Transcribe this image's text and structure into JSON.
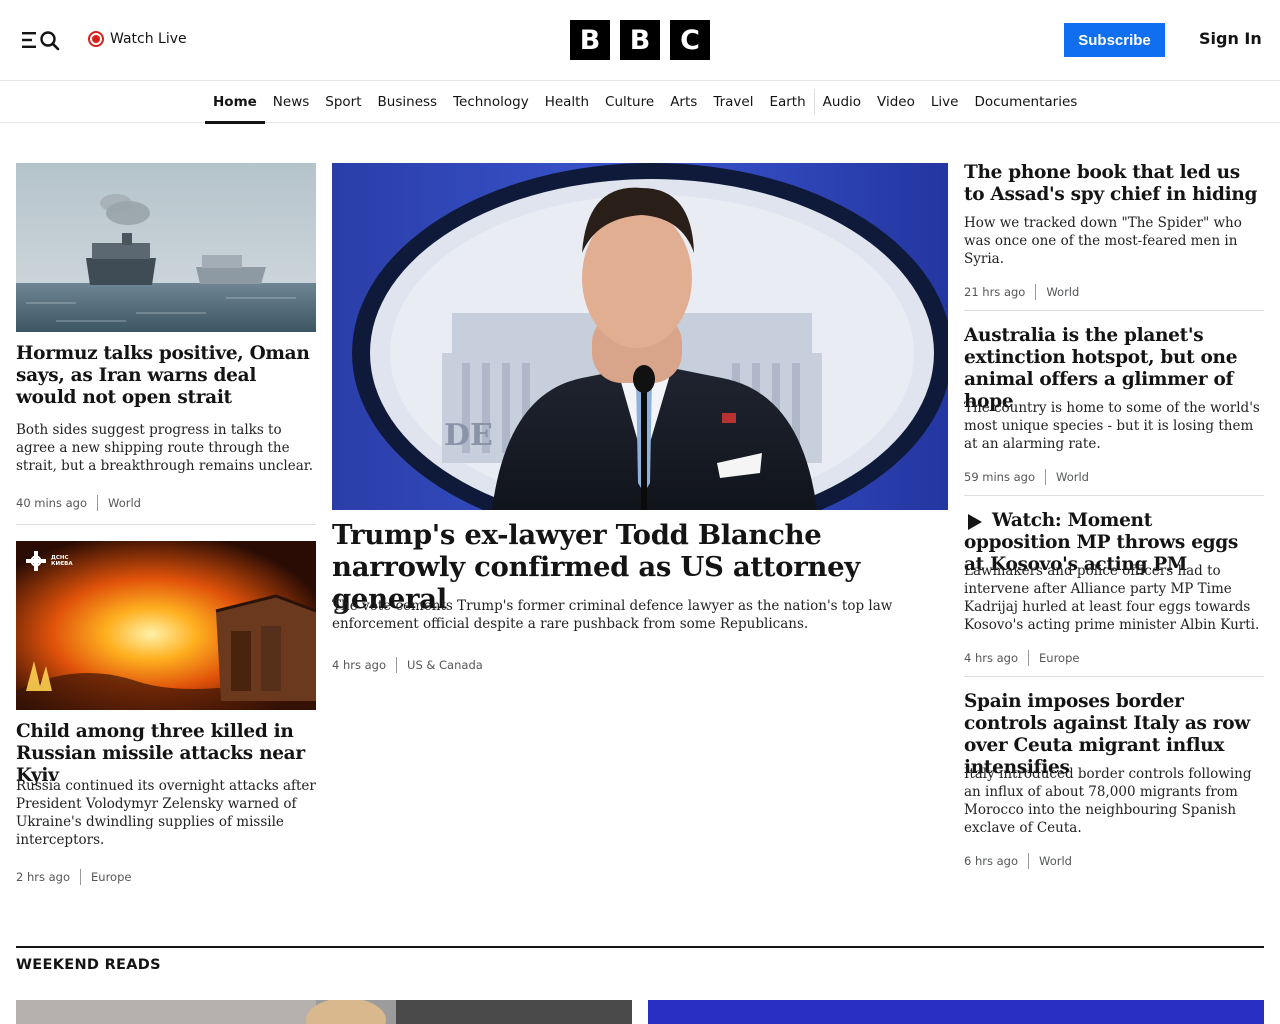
{
  "header": {
    "watch_live": "Watch Live",
    "logo": [
      "B",
      "B",
      "C"
    ],
    "subscribe": "Subscribe",
    "sign_in": "Sign In"
  },
  "nav": {
    "items": [
      "Home",
      "News",
      "Sport",
      "Business",
      "Technology",
      "Health",
      "Culture",
      "Arts",
      "Travel",
      "Earth",
      "Audio",
      "Video",
      "Live",
      "Documentaries"
    ],
    "active": "Home"
  },
  "left_stories": [
    {
      "title": "Hormuz talks positive, Oman says, as Iran warns deal would not open strait",
      "desc": "Both sides suggest progress in talks to agree a new shipping route through the strait, but a breakthrough remains unclear.",
      "time": "40 mins ago",
      "section": "World"
    },
    {
      "title": "Child among three killed in Russian missile attacks near Kyiv",
      "desc": "Russia continued its overnight attacks after President Volodymyr Zelensky warned of Ukraine's dwindling supplies of missile interceptors.",
      "time": "2 hrs ago",
      "section": "Europe",
      "image_badge": "ДСНС КИЄВА"
    }
  ],
  "main_story": {
    "title": "Trump's ex-lawyer Todd Blanche narrowly confirmed as US attorney general",
    "desc": "The vote cements Trump's former criminal defence lawyer as the nation's top law enforcement official despite a rare pushback from some Republicans.",
    "time": "4 hrs ago",
    "section": "US & Canada",
    "seal_text": "DE"
  },
  "right_stories": [
    {
      "title": "The phone book that led us to Assad's spy chief in hiding",
      "desc": "How we tracked down \"The Spider\" who was once one of the most-feared men in Syria.",
      "time": "21 hrs ago",
      "section": "World"
    },
    {
      "title": "Australia is the planet's extinction hotspot, but one animal offers a glimmer of hope",
      "desc": "The country is home to some of the world's most unique species - but it is losing them at an alarming rate.",
      "time": "59 mins ago",
      "section": "World"
    },
    {
      "title": "Watch: Moment opposition MP throws eggs at Kosovo's acting PM",
      "desc": "Lawmakers and police officers had to intervene after Alliance party MP Time Kadrijaj hurled at least four eggs towards Kosovo's acting prime minister Albin Kurti.",
      "time": "4 hrs ago",
      "section": "Europe",
      "video": true
    },
    {
      "title": "Spain imposes border controls against Italy as row over Ceuta migrant influx intensifies",
      "desc": "Italy introduced border controls following an influx of about 78,000 migrants from Morocco into the neighbouring Spanish exclave of Ceuta.",
      "time": "6 hrs ago",
      "section": "World"
    }
  ],
  "weekend": {
    "title": "WEEKEND READS"
  },
  "colors": {
    "subscribe_bg": "#0f6ff0",
    "live_red": "#d4221b",
    "text": "#141414",
    "meta": "#545658"
  }
}
